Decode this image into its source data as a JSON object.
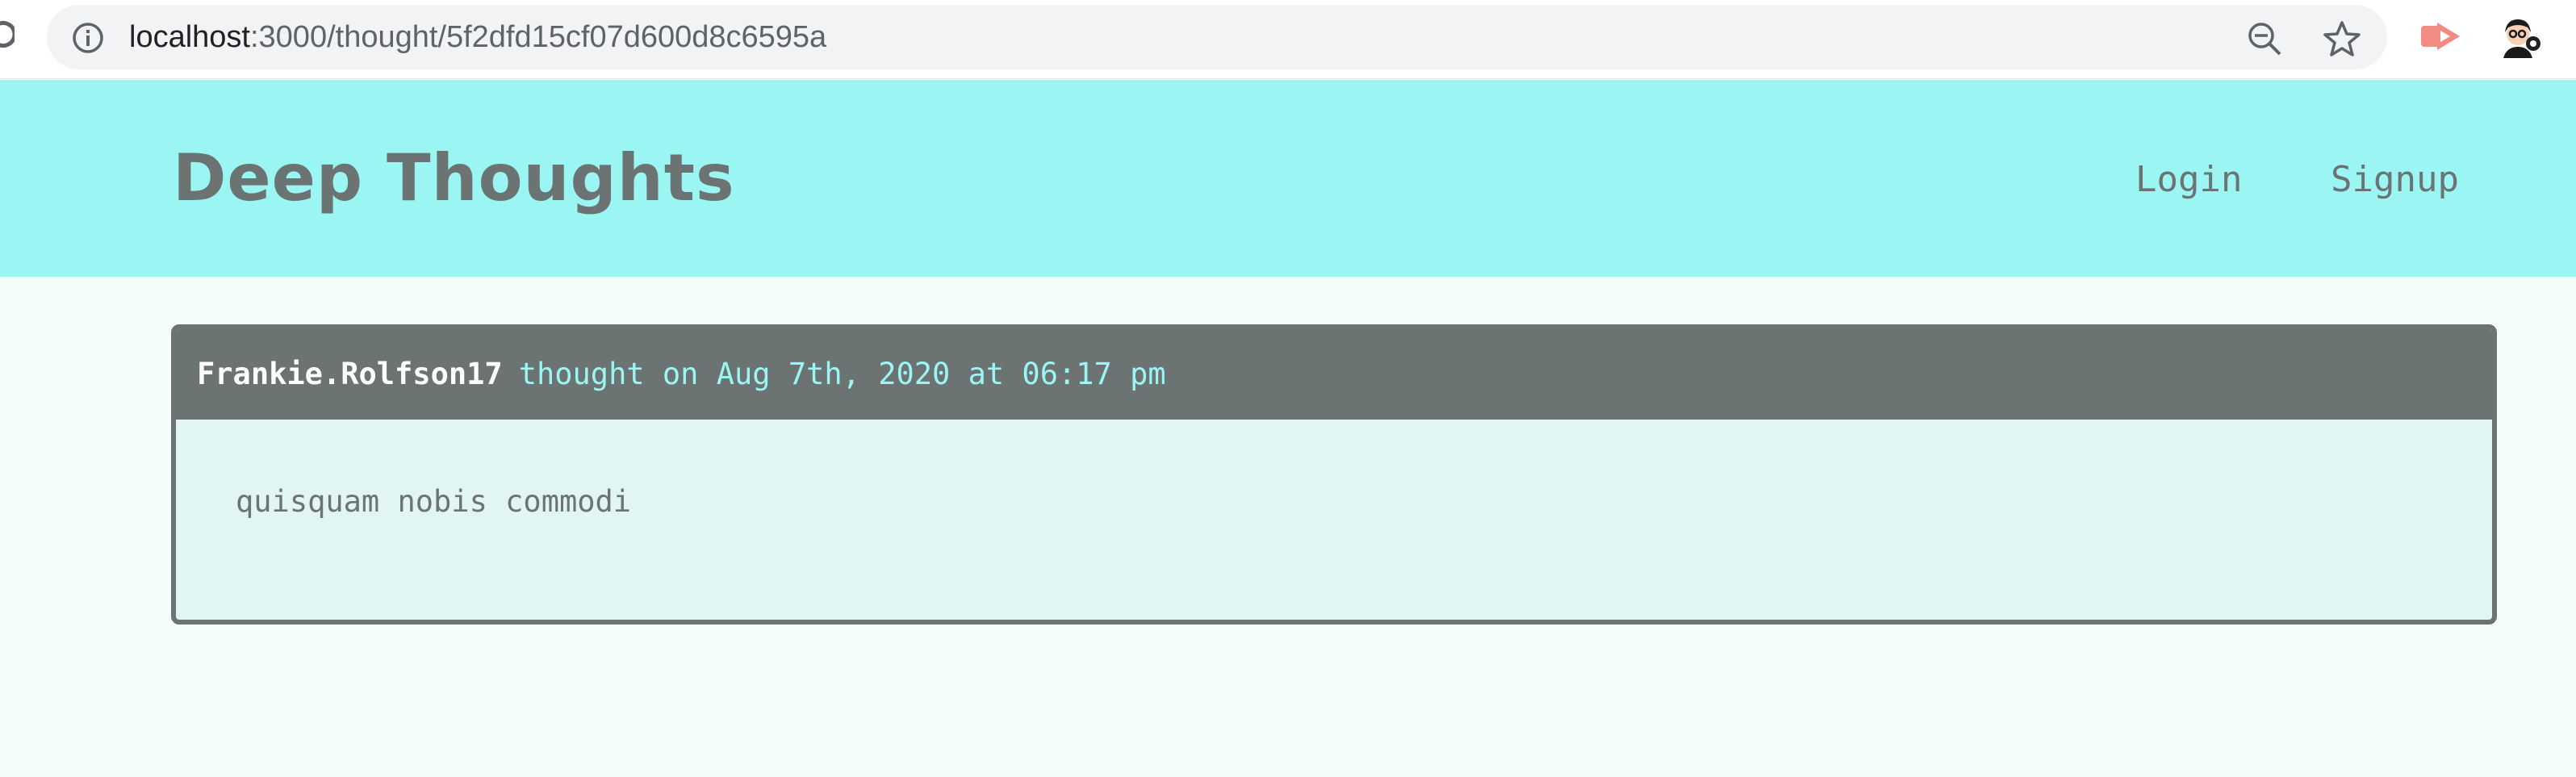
{
  "browser": {
    "url_host": "localhost",
    "url_path": ":3000/thought/5f2dfd15cf07d600d8c6595a",
    "icons": [
      "reload-icon",
      "info-icon",
      "zoom-out-icon",
      "star-icon",
      "extension-icon",
      "profile-avatar"
    ]
  },
  "header": {
    "title": "Deep Thoughts",
    "nav": {
      "login": "Login",
      "signup": "Signup"
    }
  },
  "thought": {
    "username": "Frankie.Rolfson17",
    "meta": "thought on Aug 7th, 2020 at 06:17 pm",
    "text": "quisquam nobis commodi"
  },
  "colors": {
    "header_bg": "#9bf6f3",
    "page_bg": "#f2fdfc",
    "card_header_bg": "#6c7373",
    "card_body_bg": "#e1f5f3",
    "accent_text": "#9bf6f3",
    "muted_text": "#6b7373"
  }
}
